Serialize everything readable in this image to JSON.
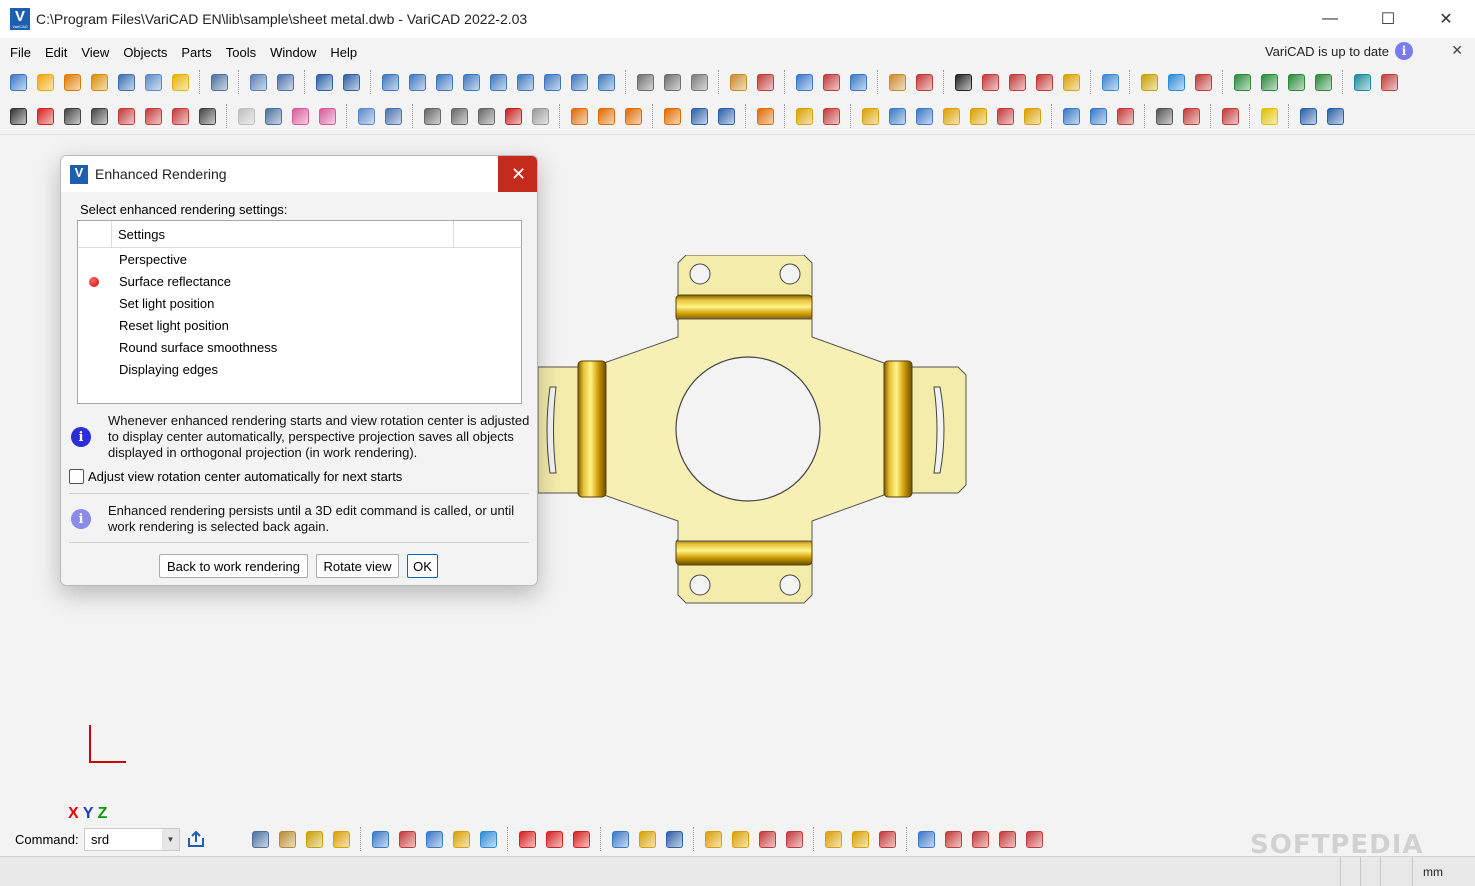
{
  "window": {
    "title": "C:\\Program Files\\VariCAD EN\\lib\\sample\\sheet metal.dwb - VariCAD 2022-2.03",
    "logo_letter": "V",
    "minimize": "—",
    "maximize": "☐",
    "close": "✕"
  },
  "menu": [
    "File",
    "Edit",
    "View",
    "Objects",
    "Parts",
    "Tools",
    "Window",
    "Help"
  ],
  "update_notice": {
    "text": "VariCAD is up to date",
    "info_glyph": "i",
    "close_glyph": "✕"
  },
  "toolbar_row1": {
    "groups": [
      [
        "#3a78c9",
        "#f0a500",
        "#e07b00",
        "#d98e00",
        "#3a6fb0",
        "#5a89c8",
        "#e5b200"
      ],
      [
        "#4a6fa0"
      ],
      [
        "#5a7fb8",
        "#4a72ac"
      ],
      [
        "#2c60a8",
        "#2c60a8"
      ],
      [
        "#3f78c0",
        "#3f78c0",
        "#3f78c0",
        "#3f78c0",
        "#3f78c0",
        "#3f78c0",
        "#3f78c0",
        "#3f78c0",
        "#3f78c0"
      ],
      [
        "#6e6e6e",
        "#6e6e6e",
        "#7a7a7a"
      ],
      [
        "#c98a2a",
        "#c43a3a"
      ],
      [
        "#3a78c9",
        "#c43a3a",
        "#3a78c9"
      ],
      [
        "#c98a2a",
        "#c43a3a"
      ],
      [
        "#222222",
        "#c43a3a",
        "#c43a3a",
        "#c43a3a",
        "#d9a000"
      ],
      [
        "#3a86d0"
      ],
      [
        "#c9a000",
        "#2c8ad8",
        "#c43a3a"
      ],
      [
        "#2a8a3a",
        "#2a8a3a",
        "#2a8a3a",
        "#2a8a3a"
      ],
      [
        "#1a8a9a",
        "#c43a3a"
      ]
    ]
  },
  "toolbar_row2": {
    "groups": [
      [
        "#333333",
        "#d82020",
        "#444444",
        "#444444",
        "#c43a3a",
        "#c43a3a",
        "#c43a3a",
        "#444444"
      ],
      [
        "#bfbfbf",
        "#4a6fa0",
        "#d85a9a",
        "#d85a9a"
      ],
      [
        "#5a89c8",
        "#4a72ac"
      ],
      [
        "#666666",
        "#666666",
        "#666666",
        "#c42020",
        "#999999"
      ],
      [
        "#e06a00",
        "#e06a00",
        "#e06a00"
      ],
      [
        "#e06a00",
        "#2c60a8",
        "#2c60a8"
      ],
      [
        "#e06a00"
      ],
      [
        "#d9a000",
        "#c43a3a"
      ],
      [
        "#d9a000",
        "#3a78c9",
        "#3a78c9",
        "#d9a000",
        "#d9a000",
        "#c43a3a",
        "#d9a000"
      ],
      [
        "#3a78c9",
        "#3a78c9",
        "#c43a3a"
      ],
      [
        "#555555",
        "#c43a3a"
      ],
      [
        "#c43a3a"
      ],
      [
        "#e0c000"
      ],
      [
        "#2c60a8",
        "#2c60a8"
      ]
    ]
  },
  "axes_label": {
    "x": "X",
    "y": "Y",
    "z": "Z"
  },
  "dialog": {
    "title": "Enhanced Rendering",
    "close_glyph": "✕",
    "prompt": "Select enhanced rendering settings:",
    "list_header": "Settings",
    "settings": [
      {
        "label": "Perspective",
        "selected": false
      },
      {
        "label": "Surface reflectance",
        "selected": true
      },
      {
        "label": "Set light position",
        "selected": false
      },
      {
        "label": "Reset light position",
        "selected": false
      },
      {
        "label": "Round surface smoothness",
        "selected": false
      },
      {
        "label": "Displaying edges",
        "selected": false
      }
    ],
    "info1": "Whenever enhanced rendering starts and view rotation center is adjusted to display center automatically, perspective projection saves all objects displayed in orthogonal projection (in work rendering).",
    "checkbox_label": "Adjust view rotation center automatically for next starts",
    "checkbox_checked": false,
    "info2": "Enhanced rendering persists until a 3D edit command is called, or until work rendering is selected back again.",
    "info_glyph": "i",
    "buttons": {
      "back": "Back to work rendering",
      "rotate": "Rotate view",
      "ok": "OK"
    }
  },
  "command_bar": {
    "label": "Command:",
    "value": "srd",
    "tools": [
      [
        "#4a6fa0",
        "#b88a30",
        "#c9a000",
        "#d9a000"
      ],
      [
        "#3a78c9",
        "#c43a3a",
        "#3a78c9",
        "#d9a000",
        "#2c8ad8"
      ],
      [
        "#d82020",
        "#d82020",
        "#d82020"
      ],
      [
        "#3a78c9",
        "#d9a000",
        "#2c60a8"
      ],
      [
        "#d9a000",
        "#d9a000",
        "#c43a3a",
        "#c43a3a"
      ],
      [
        "#d9a000",
        "#d9a000",
        "#c43a3a"
      ],
      [
        "#3a78c9",
        "#c43a3a",
        "#c43a3a",
        "#c43a3a",
        "#c43a3a"
      ]
    ]
  },
  "status_bar": {
    "unit": "mm"
  },
  "watermark": "SOFTPEDIA"
}
